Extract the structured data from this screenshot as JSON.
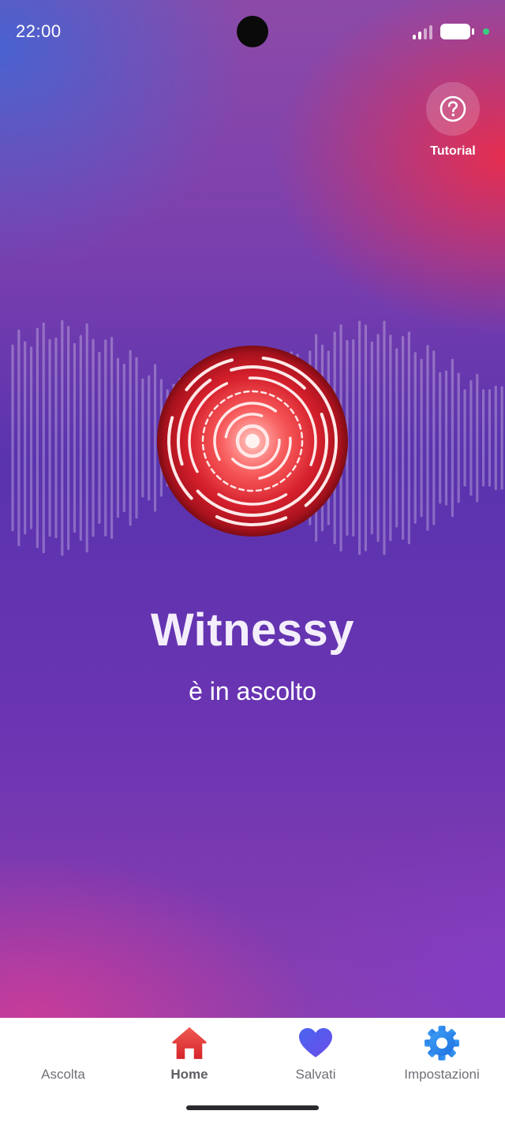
{
  "status_bar": {
    "time": "22:00"
  },
  "tutorial": {
    "label": "Tutorial",
    "icon": "help-circle-icon"
  },
  "main": {
    "title": "Witnessy",
    "subtitle": "è in ascolto"
  },
  "nav": {
    "items": [
      {
        "label": "Ascolta",
        "icon": "sound-wave-icon",
        "active": false
      },
      {
        "label": "Home",
        "icon": "home-icon",
        "active": true
      },
      {
        "label": "Salvati",
        "icon": "heart-icon",
        "active": false
      },
      {
        "label": "Impostazioni",
        "icon": "gear-icon",
        "active": false
      }
    ]
  },
  "colors": {
    "accent_red": "#e8323c",
    "nav_blue": "#2e7be6",
    "heart": "#5b5cf0",
    "sound_wave": "#1fb7e8"
  }
}
